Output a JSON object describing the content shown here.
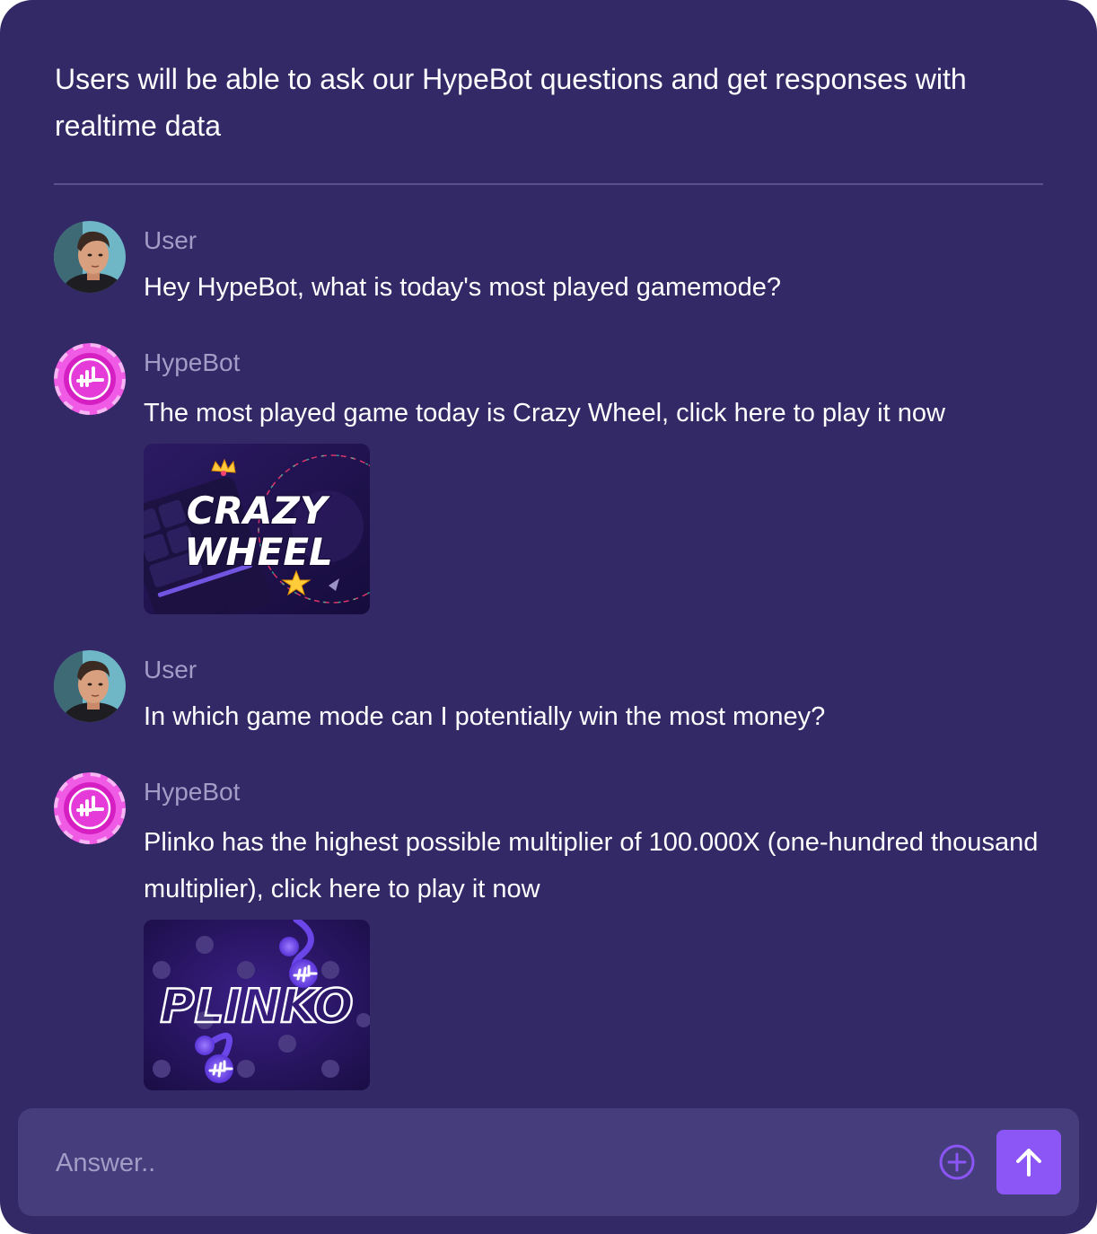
{
  "intro": {
    "text": "Users will be able to ask our HypeBot questions and get responses with realtime data"
  },
  "messages": [
    {
      "sender": "User",
      "text": "Hey HypeBot, what is today's most played gamemode?"
    },
    {
      "sender": "HypeBot",
      "text": "The most played game today is Crazy Wheel, click here to play it now",
      "thumbnail": {
        "line1": "CRAZY",
        "line2": "WHEEL",
        "logo_icon": "crazy-wheel-game-logo"
      }
    },
    {
      "sender": "User",
      "text": "In which game mode can I potentially win the most money?"
    },
    {
      "sender": "HypeBot",
      "text": "Plinko has the highest possible multiplier of 100.000X (one-hundred thousand multiplier), click here to play it now",
      "thumbnail": {
        "line1": "PLINKO",
        "logo_icon": "plinko-game-logo"
      }
    }
  ],
  "composer": {
    "placeholder": "Answer..",
    "add_icon": "plus-circle-icon",
    "send_icon": "arrow-up-icon"
  },
  "colors": {
    "background": "#322966",
    "composer": "#453d7c",
    "accent": "#8c55f5",
    "muted_text": "#a29cc6",
    "bot_avatar": "#e62ed2"
  }
}
